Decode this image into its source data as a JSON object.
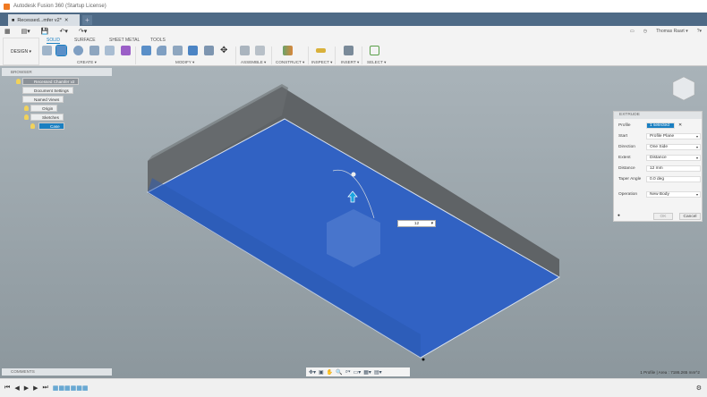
{
  "app": {
    "title": "Autodesk Fusion 360 (Startup License)"
  },
  "tab": {
    "label": "Recessed...mfer v2*",
    "new": "+"
  },
  "user": {
    "name": "Thomas Raart ▾"
  },
  "ribbon": {
    "workspace": "DESIGN ▾",
    "tabs": [
      "SOLID",
      "SURFACE",
      "SHEET METAL",
      "TOOLS"
    ],
    "groups": [
      "CREATE ▾",
      "MODIFY ▾",
      "ASSEMBLE ▾",
      "CONSTRUCT ▾",
      "INSPECT ▾",
      "INSERT ▾",
      "SELECT ▾"
    ]
  },
  "browser": {
    "title": "BROWSER",
    "root": "Recessed Chamfer v2",
    "items": [
      "Document Settings",
      "Named Views",
      "Origin",
      "Sketches"
    ],
    "sketch": "Case"
  },
  "comments": {
    "title": "COMMENTS"
  },
  "extrude": {
    "title": "EXTRUDE",
    "rows": [
      {
        "label": "Profile",
        "value": "1 selected"
      },
      {
        "label": "Start",
        "value": "Profile Plane"
      },
      {
        "label": "Direction",
        "value": "One Side"
      },
      {
        "label": "Extent",
        "value": "Distance"
      },
      {
        "label": "Distance",
        "value": "12 mm"
      },
      {
        "label": "Taper Angle",
        "value": "0.0 deg"
      },
      {
        "label": "Operation",
        "value": "New Body"
      }
    ],
    "ok": "OK",
    "cancel": "Cancel"
  },
  "dimension": {
    "value": "12"
  },
  "status": {
    "text": "1 Profile | Area : 7186.265 mm^2"
  },
  "colors": {
    "accent": "#1a7fc1",
    "profile": "#2f62c9",
    "body": "#5f6366"
  }
}
